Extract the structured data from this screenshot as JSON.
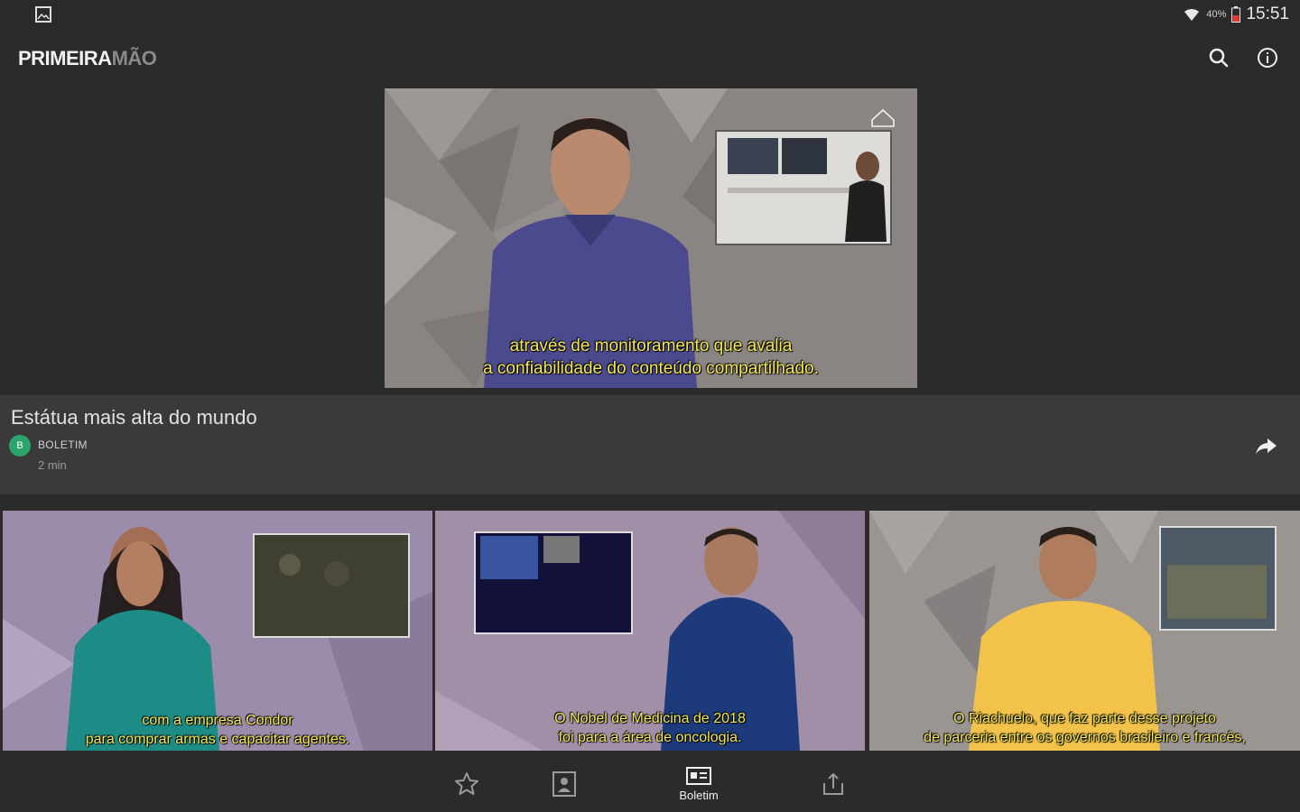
{
  "status_bar": {
    "battery_pct": "40%",
    "time": "15:51"
  },
  "app": {
    "logo_part1": "PRIMEIRA",
    "logo_part2": "MÃO"
  },
  "featured": {
    "subtitle_line1": "através de monitoramento que avalia",
    "subtitle_line2": "a confiabilidade do conteúdo compartilhado.",
    "title": "Estátua mais alta do mundo",
    "channel_initial": "B",
    "channel": "BOLETIM",
    "duration": "2 min"
  },
  "thumbnails": [
    {
      "subtitle_line1": "com a empresa Condor",
      "subtitle_line2": "para comprar armas e capacitar agentes."
    },
    {
      "subtitle_line1": "O Nobel de Medicina de 2018",
      "subtitle_line2": "foi para a área de oncologia."
    },
    {
      "subtitle_line1": "O Riachuelo, que faz parte desse projeto",
      "subtitle_line2": "de parceria entre os governos brasileiro e francês,"
    }
  ],
  "bottom_nav": {
    "items": [
      {
        "icon": "star-icon",
        "label": ""
      },
      {
        "icon": "contact-card-icon",
        "label": ""
      },
      {
        "icon": "news-card-icon",
        "label": "Boletim"
      },
      {
        "icon": "share-tray-icon",
        "label": ""
      }
    ],
    "active_index": 2
  },
  "colors": {
    "background": "#2b2b2b",
    "panel": "#3a3a3a",
    "subtitle": "#f4e85a",
    "channel_avatar": "#2aa66a"
  }
}
